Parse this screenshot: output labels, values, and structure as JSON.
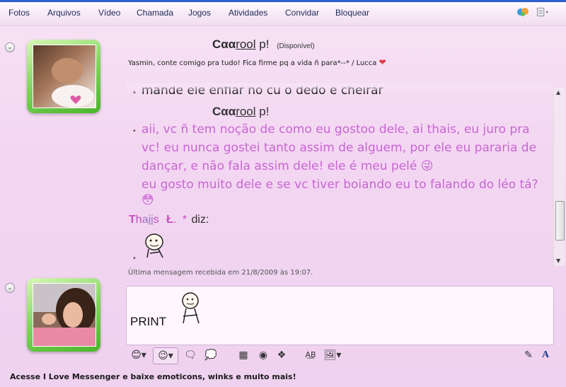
{
  "menu": {
    "items": [
      "Fotos",
      "Arquivos",
      "Vídeo",
      "Chamada",
      "Jogos",
      "Atividades",
      "Convidar",
      "Bloquear"
    ]
  },
  "contact": {
    "name": "Cαα",
    "name_underlined": "rool",
    "name_suffix": " p!",
    "status": "(Disponível)",
    "personal_message": "Yasmin, conte comigo pra tudo! Fica firme pq a vida ñ para*--* / Lucca"
  },
  "chat": {
    "cut_line": "mande ele enfiar no cu o dedo e cheirar",
    "sender1": {
      "part1": "Cαα",
      "part2": "rool",
      "part3": " p!"
    },
    "message_lines": [
      "aii, vc ñ tem noção de como eu gostoo dele, ai thais, eu juro pra",
      "vc! eu nunca gostei tanto assim de alguem, por ele eu pararia de",
      "dançar, e não fala assim dele! ele é meu pelé",
      "eu gosto muito dele e se vc tiver boiando eu to falando do léo tá?"
    ],
    "sender2": {
      "first": "T",
      "h": "h",
      "a": "a",
      "ii": "ii",
      "s": "s",
      "l": "Ł",
      "dot": ".",
      "star": "*",
      "says": "diz:"
    },
    "last_message": "Última mensagem recebida em 21/8/2009 às 19:07."
  },
  "input": {
    "text": "PRINT"
  },
  "footer": {
    "text": "Acesse I Love Messenger e baixe emoticons, winks e muito mais!"
  },
  "colors": {
    "accent": "#2f5fcf",
    "chat_text": "#c765d3",
    "avatar_frame": "#4bb52c"
  }
}
